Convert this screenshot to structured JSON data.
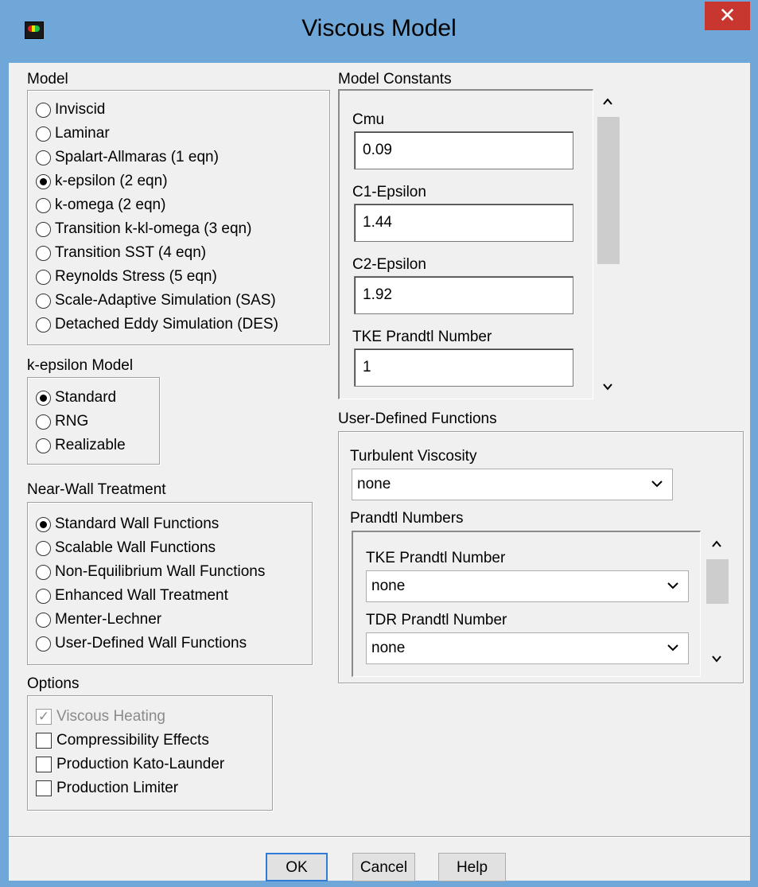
{
  "window": {
    "title": "Viscous Model",
    "close_glyph": "✕"
  },
  "model": {
    "label": "Model",
    "options": [
      {
        "label": "Inviscid",
        "selected": false
      },
      {
        "label": "Laminar",
        "selected": false
      },
      {
        "label": "Spalart-Allmaras (1 eqn)",
        "selected": false
      },
      {
        "label": "k-epsilon (2 eqn)",
        "selected": true
      },
      {
        "label": "k-omega (2 eqn)",
        "selected": false
      },
      {
        "label": "Transition k-kl-omega (3 eqn)",
        "selected": false
      },
      {
        "label": "Transition SST (4 eqn)",
        "selected": false
      },
      {
        "label": "Reynolds Stress (5 eqn)",
        "selected": false
      },
      {
        "label": "Scale-Adaptive Simulation (SAS)",
        "selected": false
      },
      {
        "label": "Detached Eddy Simulation (DES)",
        "selected": false
      }
    ]
  },
  "kepsilon": {
    "label": "k-epsilon Model",
    "options": [
      {
        "label": "Standard",
        "selected": true
      },
      {
        "label": "RNG",
        "selected": false
      },
      {
        "label": "Realizable",
        "selected": false
      }
    ]
  },
  "nearwall": {
    "label": "Near-Wall Treatment",
    "options": [
      {
        "label": "Standard Wall Functions",
        "selected": true
      },
      {
        "label": "Scalable Wall Functions",
        "selected": false
      },
      {
        "label": "Non-Equilibrium Wall Functions",
        "selected": false
      },
      {
        "label": "Enhanced Wall Treatment",
        "selected": false
      },
      {
        "label": "Menter-Lechner",
        "selected": false
      },
      {
        "label": "User-Defined Wall Functions",
        "selected": false
      }
    ]
  },
  "options": {
    "label": "Options",
    "items": [
      {
        "label": "Viscous Heating",
        "checked": true,
        "disabled": true
      },
      {
        "label": "Compressibility Effects",
        "checked": false,
        "disabled": false
      },
      {
        "label": "Production Kato-Launder",
        "checked": false,
        "disabled": false
      },
      {
        "label": "Production Limiter",
        "checked": false,
        "disabled": false
      }
    ]
  },
  "constants": {
    "label": "Model Constants",
    "fields": [
      {
        "label": "Cmu",
        "value": "0.09"
      },
      {
        "label": "C1-Epsilon",
        "value": "1.44"
      },
      {
        "label": "C2-Epsilon",
        "value": "1.92"
      },
      {
        "label": "TKE Prandtl Number",
        "value": "1"
      }
    ]
  },
  "udf": {
    "label": "User-Defined Functions",
    "turbulent_viscosity": {
      "label": "Turbulent Viscosity",
      "value": "none"
    },
    "prandtl": {
      "label": "Prandtl Numbers",
      "tke": {
        "label": "TKE Prandtl Number",
        "value": "none"
      },
      "tdr": {
        "label": "TDR Prandtl Number",
        "value": "none"
      }
    }
  },
  "buttons": {
    "ok": "OK",
    "cancel": "Cancel",
    "help": "Help"
  }
}
